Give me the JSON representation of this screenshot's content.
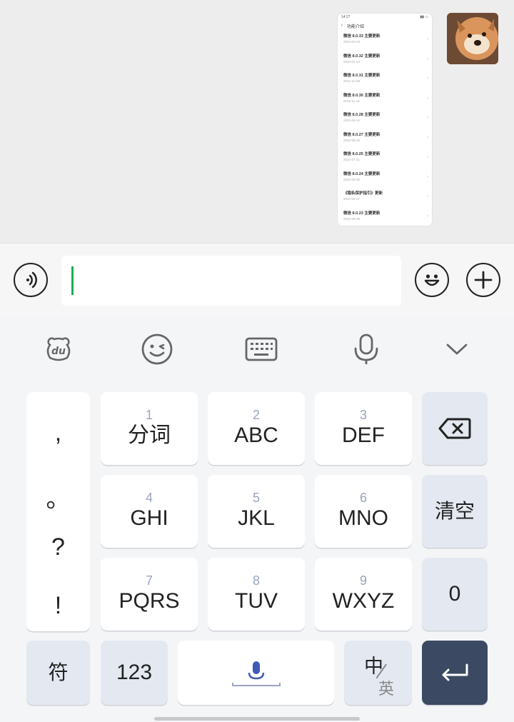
{
  "screenshot_card": {
    "status_time": "14:27",
    "nav_title": "功能介绍",
    "items": [
      {
        "title": "微信 8.0.33 主要更新",
        "date": "2023-02-23"
      },
      {
        "title": "微信 8.0.32 主要更新",
        "date": "2023-01-13"
      },
      {
        "title": "微信 8.0.31 主要更新",
        "date": "2022-12-28"
      },
      {
        "title": "微信 8.0.30 主要更新",
        "date": "2022-11-18"
      },
      {
        "title": "微信 8.0.28 主要更新",
        "date": "2022-09-14"
      },
      {
        "title": "微信 8.0.27 主要更新",
        "date": "2022-08-18"
      },
      {
        "title": "微信 8.0.25 主要更新",
        "date": "2022-07-21"
      },
      {
        "title": "微信 8.0.24 主要更新",
        "date": "2022-06-30"
      },
      {
        "title": "《隐私保护指引》更新",
        "date": "2022-06-27"
      },
      {
        "title": "微信 8.0.23 主要更新",
        "date": "2022-05-26"
      }
    ]
  },
  "input": {
    "value": "",
    "caret_color": "#1aad55"
  },
  "toolbar": {
    "icons": [
      "du-bear-icon",
      "emoji-wink-icon",
      "keyboard-icon",
      "microphone-icon",
      "chevron-down-icon"
    ]
  },
  "keyboard": {
    "punctuation": [
      ",",
      "。",
      "?",
      "!"
    ],
    "keys": [
      {
        "num": "1",
        "label": "分词"
      },
      {
        "num": "2",
        "label": "ABC"
      },
      {
        "num": "3",
        "label": "DEF"
      },
      {
        "num": "4",
        "label": "GHI"
      },
      {
        "num": "5",
        "label": "JKL"
      },
      {
        "num": "6",
        "label": "MNO"
      },
      {
        "num": "7",
        "label": "PQRS"
      },
      {
        "num": "8",
        "label": "TUV"
      },
      {
        "num": "9",
        "label": "WXYZ"
      }
    ],
    "clear": "清空",
    "zero": "0",
    "symbol": "符",
    "numeric": "123",
    "lang_primary": "中",
    "lang_secondary": "英"
  },
  "colors": {
    "accent": "#1aad55",
    "enter_key": "#3b4a62",
    "func_key": "#e3e8f1",
    "hint": "#9aa4c0"
  }
}
